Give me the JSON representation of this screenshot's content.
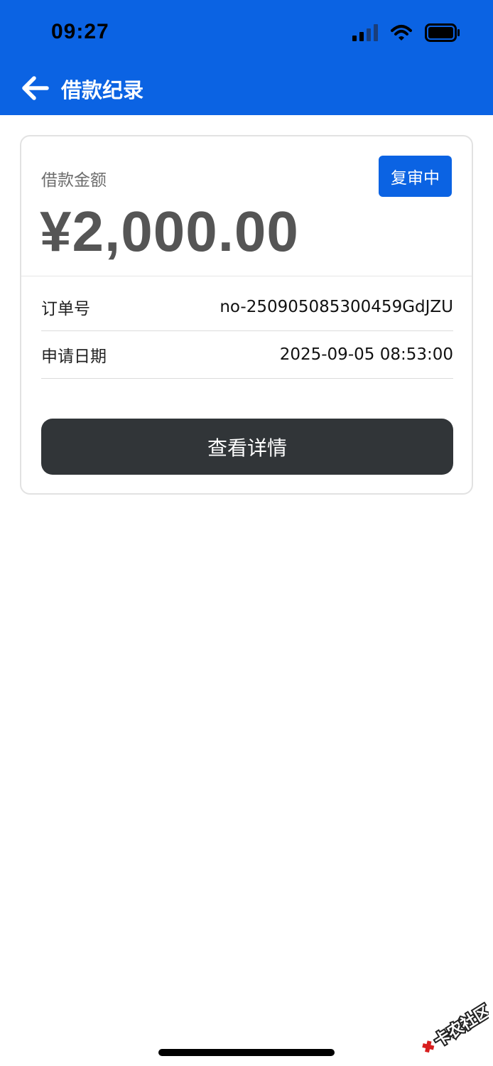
{
  "status_bar": {
    "time": "09:27",
    "icons": [
      "cellular-signal-icon",
      "wifi-icon",
      "battery-icon"
    ]
  },
  "nav": {
    "back_icon": "arrow-left-icon",
    "title": "借款纪录"
  },
  "loan_card": {
    "amount_label": "借款金额",
    "amount": "¥2,000.00",
    "status": "复审中",
    "rows": [
      {
        "label": "订单号",
        "value": "no-250905085300459GdJZU"
      },
      {
        "label": "申请日期",
        "value": "2025-09-05 08:53:00"
      }
    ],
    "detail_button": "查看详情"
  },
  "watermark": {
    "text": "卡农社区"
  },
  "colors": {
    "header_blue": "#0b63e3",
    "badge_blue": "#0b63e3",
    "button_dark": "#313538",
    "amount_gray": "#555555"
  }
}
